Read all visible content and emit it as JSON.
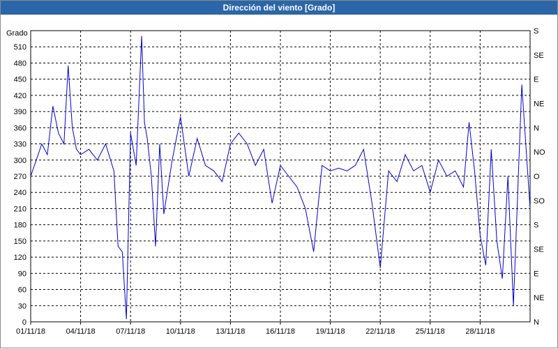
{
  "window": {
    "title": "Dirección del viento [Grado]"
  },
  "chart_data": {
    "type": "line",
    "title": "Dirección del viento [Grado]",
    "ylabel": "Grado",
    "ylim": [
      0,
      540
    ],
    "xlim": [
      "2018-11-01",
      "2018-12-01"
    ],
    "grid": true,
    "y_ticks": [
      0,
      30,
      60,
      90,
      120,
      150,
      180,
      210,
      240,
      270,
      300,
      330,
      360,
      390,
      420,
      450,
      480,
      510
    ],
    "y2_ticks": [
      "N",
      "NE",
      "E",
      "SE",
      "S",
      "SO",
      "O",
      "NO",
      "N",
      "NE",
      "E",
      "SE",
      "S"
    ],
    "x_tick_labels": [
      "01/11/18",
      "04/11/18",
      "07/11/18",
      "10/11/18",
      "13/11/18",
      "16/11/18",
      "19/11/18",
      "22/11/18",
      "25/11/18",
      "28/11/18"
    ],
    "series": [
      {
        "color": "#0000cc",
        "x": [
          "2018-11-01 00:00",
          "2018-11-01 08:00",
          "2018-11-01 16:00",
          "2018-11-02 00:00",
          "2018-11-02 08:00",
          "2018-11-02 16:00",
          "2018-11-03 00:00",
          "2018-11-03 06:00",
          "2018-11-03 12:00",
          "2018-11-03 18:00",
          "2018-11-04 00:00",
          "2018-11-04 12:00",
          "2018-11-05 00:00",
          "2018-11-05 12:00",
          "2018-11-06 00:00",
          "2018-11-06 06:00",
          "2018-11-06 12:00",
          "2018-11-06 18:00",
          "2018-11-07 00:00",
          "2018-11-07 08:00",
          "2018-11-07 16:00",
          "2018-11-07 20:00",
          "2018-11-08 00:00",
          "2018-11-08 06:00",
          "2018-11-08 12:00",
          "2018-11-08 18:00",
          "2018-11-09 00:00",
          "2018-11-09 12:00",
          "2018-11-10 00:00",
          "2018-11-10 12:00",
          "2018-11-11 00:00",
          "2018-11-11 12:00",
          "2018-11-12 00:00",
          "2018-11-12 12:00",
          "2018-11-13 00:00",
          "2018-11-13 12:00",
          "2018-11-14 00:00",
          "2018-11-14 12:00",
          "2018-11-15 00:00",
          "2018-11-15 12:00",
          "2018-11-16 00:00",
          "2018-11-16 12:00",
          "2018-11-17 00:00",
          "2018-11-17 12:00",
          "2018-11-18 00:00",
          "2018-11-18 12:00",
          "2018-11-19 00:00",
          "2018-11-19 12:00",
          "2018-11-20 00:00",
          "2018-11-20 12:00",
          "2018-11-21 00:00",
          "2018-11-21 12:00",
          "2018-11-22 00:00",
          "2018-11-22 12:00",
          "2018-11-23 00:00",
          "2018-11-23 12:00",
          "2018-11-24 00:00",
          "2018-11-24 12:00",
          "2018-11-25 00:00",
          "2018-11-25 12:00",
          "2018-11-26 00:00",
          "2018-11-26 12:00",
          "2018-11-27 00:00",
          "2018-11-27 08:00",
          "2018-11-27 16:00",
          "2018-11-28 00:00",
          "2018-11-28 08:00",
          "2018-11-28 16:00",
          "2018-11-29 00:00",
          "2018-11-29 08:00",
          "2018-11-29 16:00",
          "2018-11-30 00:00",
          "2018-11-30 12:00",
          "2018-12-01 00:00"
        ],
        "y": [
          270,
          300,
          330,
          310,
          400,
          350,
          330,
          475,
          360,
          320,
          310,
          320,
          300,
          330,
          280,
          140,
          130,
          5,
          350,
          290,
          530,
          370,
          340,
          270,
          140,
          330,
          200,
          300,
          380,
          270,
          340,
          290,
          280,
          260,
          330,
          350,
          330,
          290,
          320,
          220,
          290,
          270,
          250,
          210,
          130,
          290,
          280,
          285,
          280,
          290,
          320,
          220,
          100,
          280,
          260,
          310,
          280,
          290,
          240,
          300,
          270,
          280,
          250,
          370,
          280,
          160,
          105,
          320,
          150,
          80,
          270,
          30,
          440,
          210
        ]
      }
    ]
  }
}
